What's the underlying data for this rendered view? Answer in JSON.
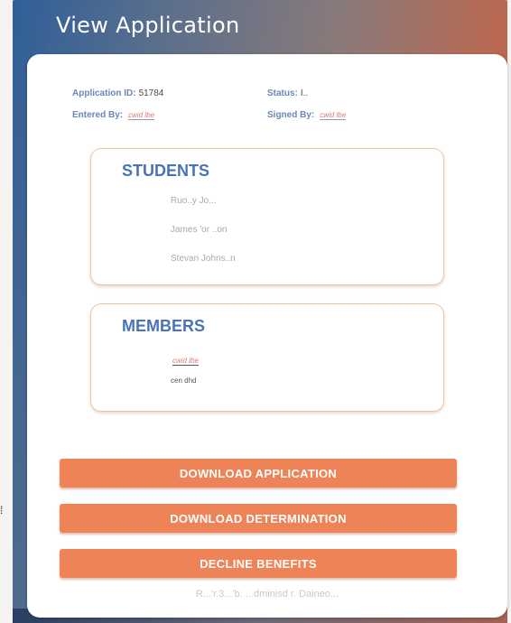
{
  "page": {
    "title": "View Application"
  },
  "meta": {
    "application_id_label": "Application ID:",
    "application_id_value": "51784",
    "status_label": "Status:",
    "status_value": "I..",
    "entered_by_label": "Entered By:",
    "entered_by_value": "cwid lbe",
    "signed_by_label": "Signed By:",
    "signed_by_value": "cwid lbe"
  },
  "students": {
    "heading": "STUDENTS",
    "items": [
      "Ruo..y Jo...",
      "James 'or ..on",
      "Stevan Johns..n"
    ]
  },
  "members": {
    "heading": "MEMBERS",
    "items": [
      "cwid lbe",
      "cen dhd"
    ]
  },
  "buttons": {
    "download_application": "DOWNLOAD APPLICATION",
    "download_determination": "DOWNLOAD DETERMINATION",
    "decline_benefits": "DECLINE BENEFITS"
  },
  "footer": {
    "link_text": "R...'r.3...'b. ...dminisd r. Daineo..."
  },
  "colors": {
    "accent": "#ee8358",
    "heading": "#4a72b8",
    "label": "#6a86b8"
  }
}
